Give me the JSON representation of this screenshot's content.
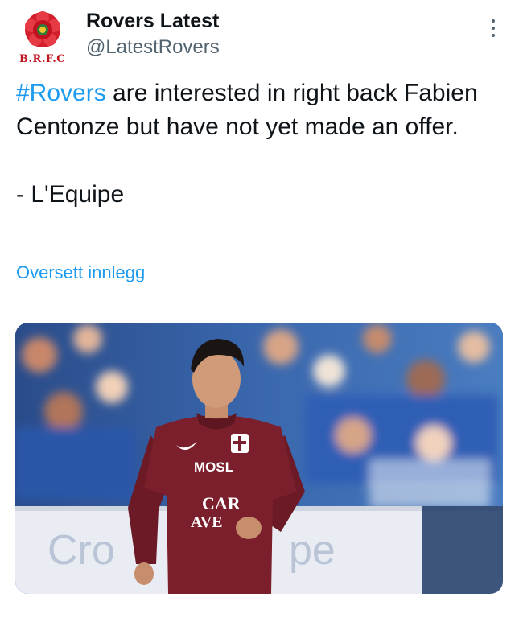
{
  "author": {
    "display_name": "Rovers Latest",
    "handle": "@LatestRovers",
    "avatar_label": "B.R.F.C",
    "avatar_icon": "rose-crest-icon"
  },
  "tweet": {
    "hashtag": "#Rovers",
    "text_after_hashtag": " are interested in right back Fabien Centonze but have not yet made an offer.",
    "source_line": "- L'Equipe",
    "translate_label": "Oversett innlegg"
  },
  "media": {
    "shirt_sponsor_top": "MOSL",
    "shirt_sponsor_bottom_1": "CAR",
    "shirt_sponsor_bottom_2": "AVE",
    "board_text_left": "Cro",
    "board_text_right": "pe"
  },
  "colors": {
    "link": "#1d9bf0",
    "secondary": "#536471",
    "brand_red": "#c1121f",
    "jersey": "#7a1f2b"
  },
  "icons": {
    "more": "more-vertical-icon"
  }
}
